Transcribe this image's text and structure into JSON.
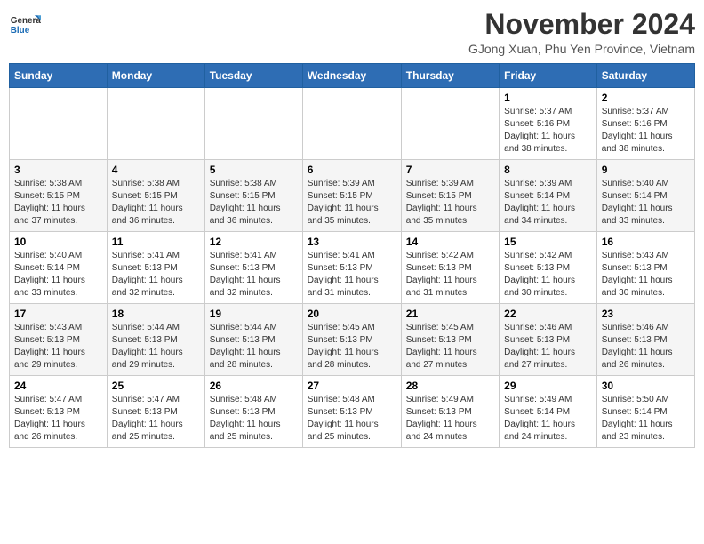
{
  "header": {
    "logo": {
      "general": "General",
      "blue": "Blue"
    },
    "title": "November 2024",
    "location": "GJong Xuan, Phu Yen Province, Vietnam"
  },
  "calendar": {
    "days_of_week": [
      "Sunday",
      "Monday",
      "Tuesday",
      "Wednesday",
      "Thursday",
      "Friday",
      "Saturday"
    ],
    "weeks": [
      [
        {
          "day": "",
          "info": ""
        },
        {
          "day": "",
          "info": ""
        },
        {
          "day": "",
          "info": ""
        },
        {
          "day": "",
          "info": ""
        },
        {
          "day": "",
          "info": ""
        },
        {
          "day": "1",
          "info": "Sunrise: 5:37 AM\nSunset: 5:16 PM\nDaylight: 11 hours\nand 38 minutes."
        },
        {
          "day": "2",
          "info": "Sunrise: 5:37 AM\nSunset: 5:16 PM\nDaylight: 11 hours\nand 38 minutes."
        }
      ],
      [
        {
          "day": "3",
          "info": "Sunrise: 5:38 AM\nSunset: 5:15 PM\nDaylight: 11 hours\nand 37 minutes."
        },
        {
          "day": "4",
          "info": "Sunrise: 5:38 AM\nSunset: 5:15 PM\nDaylight: 11 hours\nand 36 minutes."
        },
        {
          "day": "5",
          "info": "Sunrise: 5:38 AM\nSunset: 5:15 PM\nDaylight: 11 hours\nand 36 minutes."
        },
        {
          "day": "6",
          "info": "Sunrise: 5:39 AM\nSunset: 5:15 PM\nDaylight: 11 hours\nand 35 minutes."
        },
        {
          "day": "7",
          "info": "Sunrise: 5:39 AM\nSunset: 5:15 PM\nDaylight: 11 hours\nand 35 minutes."
        },
        {
          "day": "8",
          "info": "Sunrise: 5:39 AM\nSunset: 5:14 PM\nDaylight: 11 hours\nand 34 minutes."
        },
        {
          "day": "9",
          "info": "Sunrise: 5:40 AM\nSunset: 5:14 PM\nDaylight: 11 hours\nand 33 minutes."
        }
      ],
      [
        {
          "day": "10",
          "info": "Sunrise: 5:40 AM\nSunset: 5:14 PM\nDaylight: 11 hours\nand 33 minutes."
        },
        {
          "day": "11",
          "info": "Sunrise: 5:41 AM\nSunset: 5:13 PM\nDaylight: 11 hours\nand 32 minutes."
        },
        {
          "day": "12",
          "info": "Sunrise: 5:41 AM\nSunset: 5:13 PM\nDaylight: 11 hours\nand 32 minutes."
        },
        {
          "day": "13",
          "info": "Sunrise: 5:41 AM\nSunset: 5:13 PM\nDaylight: 11 hours\nand 31 minutes."
        },
        {
          "day": "14",
          "info": "Sunrise: 5:42 AM\nSunset: 5:13 PM\nDaylight: 11 hours\nand 31 minutes."
        },
        {
          "day": "15",
          "info": "Sunrise: 5:42 AM\nSunset: 5:13 PM\nDaylight: 11 hours\nand 30 minutes."
        },
        {
          "day": "16",
          "info": "Sunrise: 5:43 AM\nSunset: 5:13 PM\nDaylight: 11 hours\nand 30 minutes."
        }
      ],
      [
        {
          "day": "17",
          "info": "Sunrise: 5:43 AM\nSunset: 5:13 PM\nDaylight: 11 hours\nand 29 minutes."
        },
        {
          "day": "18",
          "info": "Sunrise: 5:44 AM\nSunset: 5:13 PM\nDaylight: 11 hours\nand 29 minutes."
        },
        {
          "day": "19",
          "info": "Sunrise: 5:44 AM\nSunset: 5:13 PM\nDaylight: 11 hours\nand 28 minutes."
        },
        {
          "day": "20",
          "info": "Sunrise: 5:45 AM\nSunset: 5:13 PM\nDaylight: 11 hours\nand 28 minutes."
        },
        {
          "day": "21",
          "info": "Sunrise: 5:45 AM\nSunset: 5:13 PM\nDaylight: 11 hours\nand 27 minutes."
        },
        {
          "day": "22",
          "info": "Sunrise: 5:46 AM\nSunset: 5:13 PM\nDaylight: 11 hours\nand 27 minutes."
        },
        {
          "day": "23",
          "info": "Sunrise: 5:46 AM\nSunset: 5:13 PM\nDaylight: 11 hours\nand 26 minutes."
        }
      ],
      [
        {
          "day": "24",
          "info": "Sunrise: 5:47 AM\nSunset: 5:13 PM\nDaylight: 11 hours\nand 26 minutes."
        },
        {
          "day": "25",
          "info": "Sunrise: 5:47 AM\nSunset: 5:13 PM\nDaylight: 11 hours\nand 25 minutes."
        },
        {
          "day": "26",
          "info": "Sunrise: 5:48 AM\nSunset: 5:13 PM\nDaylight: 11 hours\nand 25 minutes."
        },
        {
          "day": "27",
          "info": "Sunrise: 5:48 AM\nSunset: 5:13 PM\nDaylight: 11 hours\nand 25 minutes."
        },
        {
          "day": "28",
          "info": "Sunrise: 5:49 AM\nSunset: 5:13 PM\nDaylight: 11 hours\nand 24 minutes."
        },
        {
          "day": "29",
          "info": "Sunrise: 5:49 AM\nSunset: 5:14 PM\nDaylight: 11 hours\nand 24 minutes."
        },
        {
          "day": "30",
          "info": "Sunrise: 5:50 AM\nSunset: 5:14 PM\nDaylight: 11 hours\nand 23 minutes."
        }
      ]
    ]
  }
}
